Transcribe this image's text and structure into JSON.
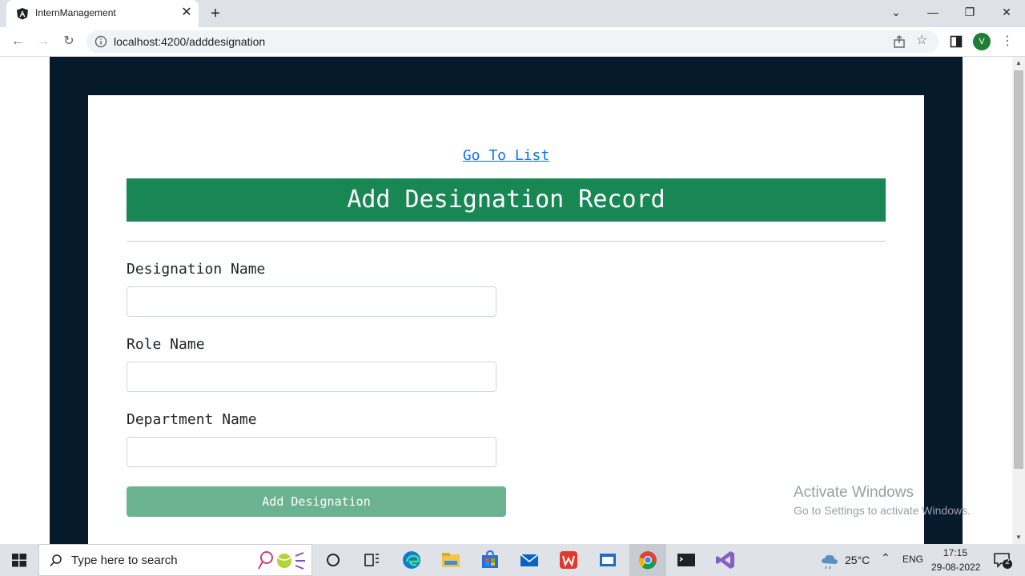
{
  "browser": {
    "tab_title": "InternManagement",
    "url": "localhost:4200/adddesignation",
    "profile_initial": "V"
  },
  "page": {
    "goto_link": "Go To List",
    "header": "Add Designation Record",
    "fields": [
      {
        "label": "Designation Name",
        "value": ""
      },
      {
        "label": "Role Name",
        "value": ""
      },
      {
        "label": "Department Name",
        "value": ""
      }
    ],
    "submit_label": "Add Designation",
    "colors": {
      "frame": "#071a2c",
      "header": "#198754",
      "button": "#6bb290",
      "link": "#0d6efd"
    }
  },
  "watermark": {
    "line1": "Activate Windows",
    "line2": "Go to Settings to activate Windows."
  },
  "taskbar": {
    "search_placeholder": "Type here to search",
    "temperature": "25°C",
    "language": "ENG",
    "time": "17:15",
    "date": "29-08-2022",
    "notification_count": "2"
  }
}
